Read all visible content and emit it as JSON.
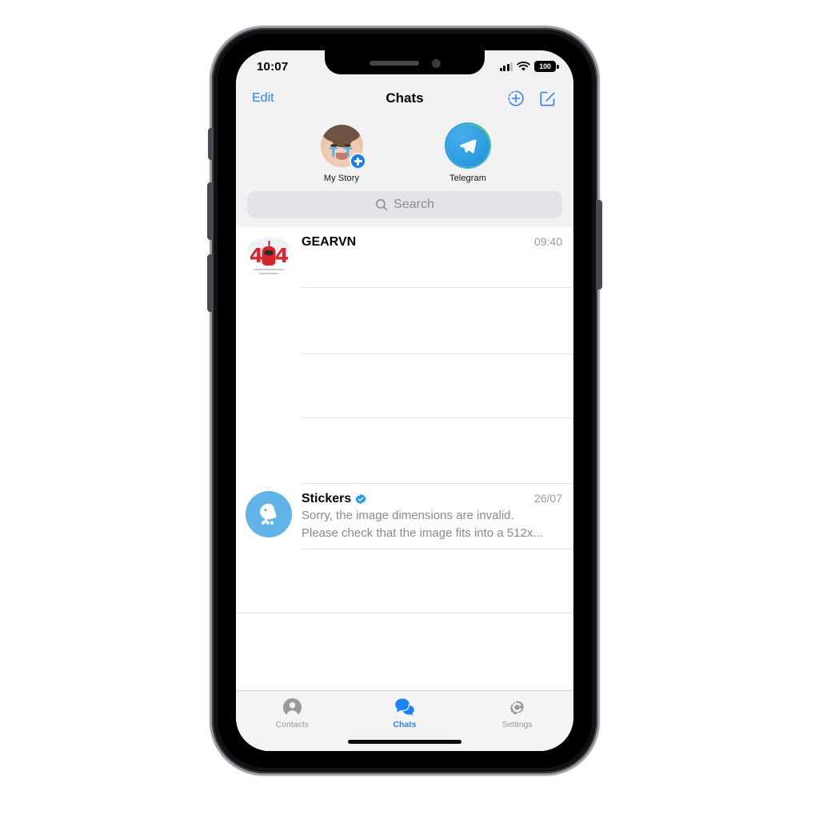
{
  "device": {
    "name": "iphone-x-frame",
    "buttons": [
      "silent-switch",
      "volume-up",
      "volume-down",
      "power"
    ]
  },
  "status_bar": {
    "time": "10:07",
    "signal_bars_filled": 3,
    "signal_bars_total": 4,
    "wifi": "wifi-icon",
    "battery_percent": "100"
  },
  "nav": {
    "edit_label": "Edit",
    "title": "Chats",
    "actions": [
      {
        "name": "add-contact-icon",
        "label": "Add"
      },
      {
        "name": "compose-icon",
        "label": "Compose"
      }
    ]
  },
  "stories": [
    {
      "label": "My Story",
      "avatar": "baby-photo",
      "has_add_badge": true,
      "ring": "none"
    },
    {
      "label": "Telegram",
      "avatar": "telegram-logo",
      "has_add_badge": false,
      "ring": "unseen"
    }
  ],
  "search": {
    "placeholder": "Search",
    "icon": "search-icon",
    "value": ""
  },
  "chats": [
    {
      "id": "gearvn",
      "name": "GEARVN",
      "verified": false,
      "time": "09:40",
      "message": "",
      "avatar": "404-error-image"
    },
    {
      "id": "stickers",
      "name": "Stickers",
      "verified": true,
      "time": "26/07",
      "message_line1": "Sorry, the image dimensions are invalid.",
      "message_line2": "Please check that the image fits into a 512x...",
      "avatar": "sticker-duck-icon"
    }
  ],
  "blank_rows": 4,
  "tabs": [
    {
      "id": "contacts",
      "label": "Contacts",
      "icon": "contacts-icon",
      "active": false
    },
    {
      "id": "chats",
      "label": "Chats",
      "icon": "chats-icon",
      "active": true
    },
    {
      "id": "settings",
      "label": "Settings",
      "icon": "settings-gear-icon",
      "active": false
    }
  ],
  "colors": {
    "accent": "#2f82ec",
    "telegram_blue": "#2e9fe0",
    "verified_blue": "#1d9bf0",
    "sticker_blue": "#62b4e8",
    "error_red": "#e0242b",
    "header_bg": "#f2f2f2",
    "search_bg": "#e4e4e6",
    "secondary_text": "#8a8a8e",
    "separator": "#e3e3e5"
  }
}
